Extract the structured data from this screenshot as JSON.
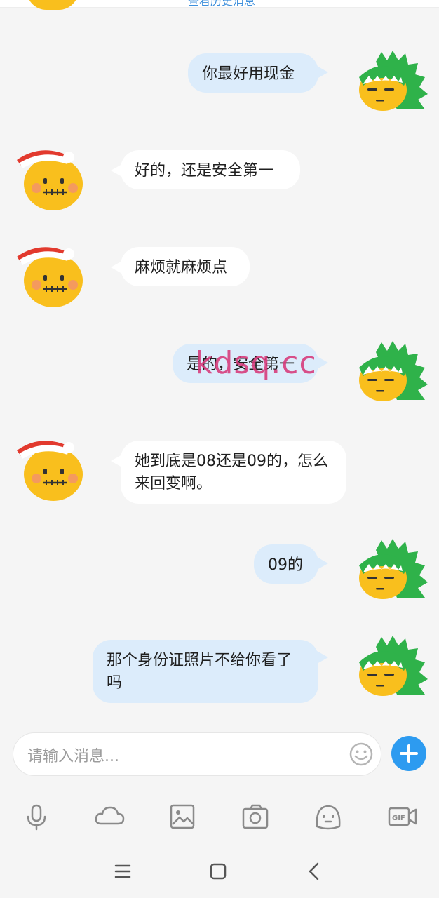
{
  "top": {
    "partial_label": "查看历史消息"
  },
  "messages": [
    {
      "side": "out",
      "text": "你最好用现金"
    },
    {
      "side": "in",
      "text": "好的，还是安全第一"
    },
    {
      "side": "in",
      "text": "麻烦就麻烦点"
    },
    {
      "side": "out",
      "text": "是的，安全第一"
    },
    {
      "side": "in",
      "text": "她到底是08还是09的，怎么来回变啊。"
    },
    {
      "side": "out",
      "text": "09的"
    },
    {
      "side": "out",
      "text": "那个身份证照片不给你看了吗"
    }
  ],
  "watermark": "kdsq.cc",
  "input": {
    "placeholder": "请输入消息..."
  },
  "toolbar_icons": [
    "microphone-icon",
    "cloud-icon",
    "image-icon",
    "camera-icon",
    "sticker-icon",
    "gif-camera-icon"
  ],
  "nav_icons": [
    "menu-icon",
    "home-icon",
    "back-icon"
  ],
  "colors": {
    "accent": "#2d9bf0",
    "out_bubble": "#dcecfb",
    "in_bubble": "#ffffff",
    "watermark": "#d7397a"
  }
}
